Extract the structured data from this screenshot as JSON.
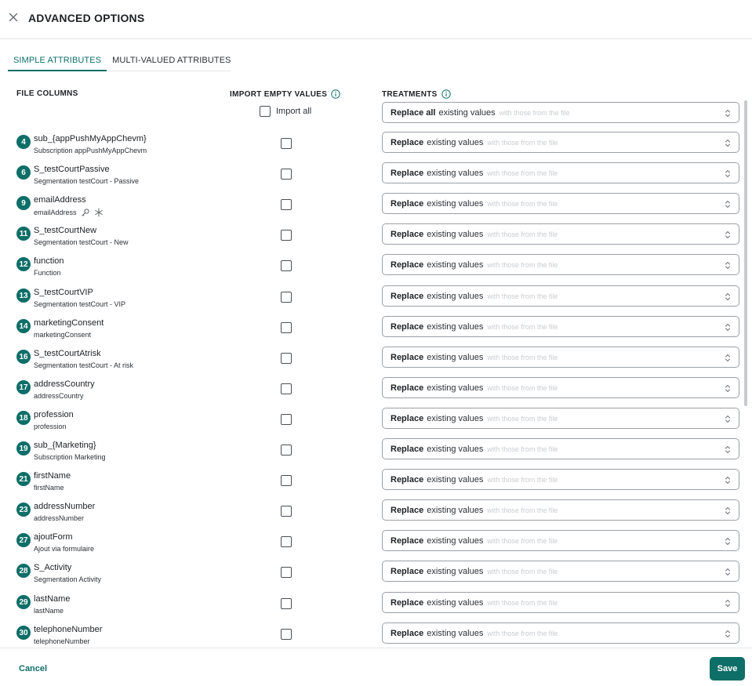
{
  "header": {
    "title": "ADVANCED OPTIONS",
    "close_icon": "close-icon"
  },
  "tabs": [
    {
      "label": "SIMPLE ATTRIBUTES",
      "active": true
    },
    {
      "label": "MULTI-VALUED ATTRIBUTES",
      "active": false
    }
  ],
  "columns": {
    "file_columns": "FILE COLUMNS",
    "import_empty_values": "IMPORT EMPTY VALUES",
    "treatments": "TREATMENTS"
  },
  "import_all": {
    "label": "Import all",
    "checked": false
  },
  "global_treatment": {
    "strong": "Replace all",
    "normal": "existing values",
    "faint": "with those from the file"
  },
  "row_treatment": {
    "strong": "Replace",
    "normal": "existing values",
    "faint": "with those from the file"
  },
  "rows": [
    {
      "num": "4",
      "name": "sub_{appPushMyAppChevm}",
      "label": "Subscription appPushMyAppChevm"
    },
    {
      "num": "6",
      "name": "S_testCourtPassive",
      "label": "Segmentation testCourt - Passive"
    },
    {
      "num": "9",
      "name": "emailAddress",
      "label": "emailAddress",
      "icons": [
        "key-icon",
        "asterisk-icon"
      ]
    },
    {
      "num": "11",
      "name": "S_testCourtNew",
      "label": "Segmentation testCourt - New"
    },
    {
      "num": "12",
      "name": "function",
      "label": "Function"
    },
    {
      "num": "13",
      "name": "S_testCourtVIP",
      "label": "Segmentation testCourt - VIP"
    },
    {
      "num": "14",
      "name": "marketingConsent",
      "label": "marketingConsent"
    },
    {
      "num": "16",
      "name": "S_testCourtAtrisk",
      "label": "Segmentation testCourt - At risk"
    },
    {
      "num": "17",
      "name": "addressCountry",
      "label": "addressCountry"
    },
    {
      "num": "18",
      "name": "profession",
      "label": "profession"
    },
    {
      "num": "19",
      "name": "sub_{Marketing}",
      "label": "Subscription Marketing"
    },
    {
      "num": "21",
      "name": "firstName",
      "label": "firstName"
    },
    {
      "num": "23",
      "name": "addressNumber",
      "label": "addressNumber"
    },
    {
      "num": "27",
      "name": "ajoutForm",
      "label": "Ajout via formulaire"
    },
    {
      "num": "28",
      "name": "S_Activity",
      "label": "Segmentation Activity"
    },
    {
      "num": "29",
      "name": "lastName",
      "label": "lastName"
    },
    {
      "num": "30",
      "name": "telephoneNumber",
      "label": "telephoneNumber"
    }
  ],
  "footer": {
    "cancel_label": "Cancel",
    "save_label": "Save"
  },
  "colors": {
    "accent": "#0e6e68",
    "border": "#9aa0a6"
  }
}
